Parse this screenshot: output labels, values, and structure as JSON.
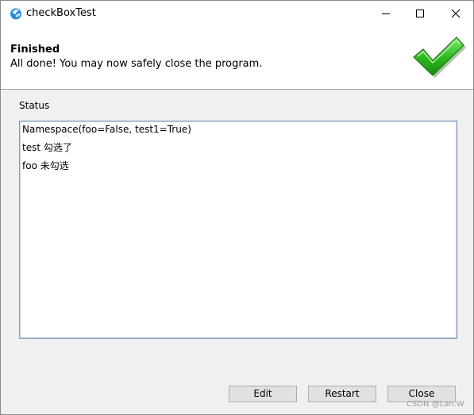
{
  "window": {
    "title": "checkBoxTest",
    "icon": "app-logo-icon",
    "controls": {
      "minimize": "minimize-icon",
      "maximize": "maximize-icon",
      "close": "close-icon"
    }
  },
  "header": {
    "title": "Finished",
    "subtitle": "All done! You may now safely close the program.",
    "icon": "checkmark-icon"
  },
  "status": {
    "label": "Status",
    "lines": [
      "Namespace(foo=False, test1=True)",
      "test 勾选了",
      "foo 未勾选"
    ]
  },
  "buttons": {
    "edit": "Edit",
    "restart": "Restart",
    "close": "Close"
  },
  "watermark": "CSDN @Lan.W",
  "colors": {
    "accent_check": "#2db81e",
    "app_icon": "#2a8be0",
    "button_face": "#e1e1e1",
    "panel_bg": "#f0f0f0"
  }
}
